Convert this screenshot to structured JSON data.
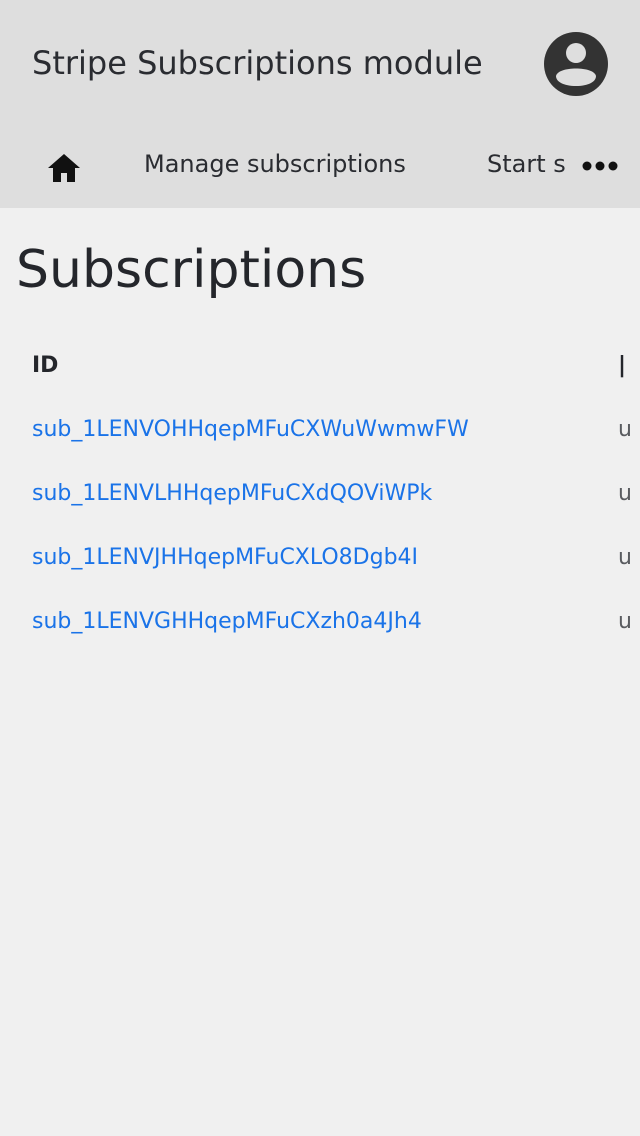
{
  "app": {
    "title": "Stripe Subscriptions module",
    "avatar_icon": "account-circle-icon"
  },
  "nav": {
    "home_icon": "home-icon",
    "tabs": [
      {
        "label": "Manage subscriptions"
      },
      {
        "label": "Start s"
      }
    ],
    "more_icon": "more-horizontal-icon"
  },
  "main": {
    "title": "Subscriptions",
    "table": {
      "columns": [
        "ID"
      ],
      "rows": [
        {
          "id": "sub_1LENVOHHqepMFuCXWuWwmwFW"
        },
        {
          "id": "sub_1LENVLHHqepMFuCXdQOViWPk"
        },
        {
          "id": "sub_1LENVJHHqepMFuCXLO8Dgb4I"
        },
        {
          "id": "sub_1LENVGHHqepMFuCXzh0a4Jh4"
        }
      ]
    }
  },
  "colors": {
    "header_bg": "#dedede",
    "page_bg": "#f0f0f0",
    "link": "#1a73e8",
    "text": "#24262b"
  }
}
